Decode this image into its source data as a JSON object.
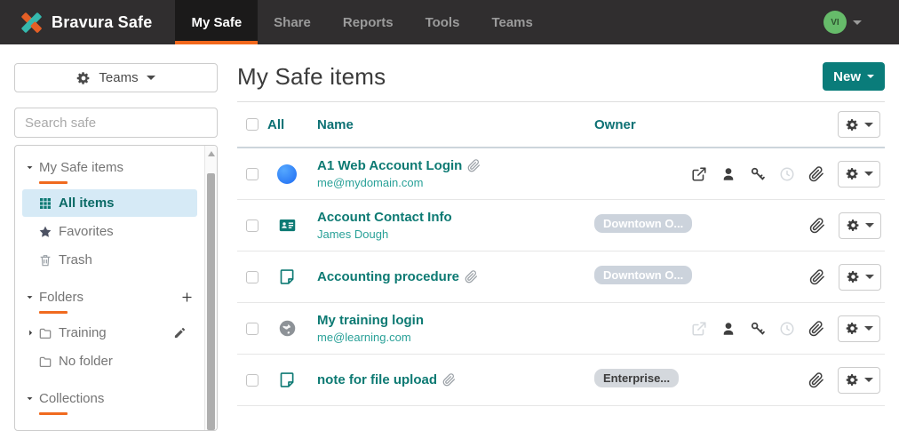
{
  "navbar": {
    "brand": "Bravura Safe",
    "items": [
      {
        "label": "My Safe",
        "active": true
      },
      {
        "label": "Share",
        "active": false
      },
      {
        "label": "Reports",
        "active": false
      },
      {
        "label": "Tools",
        "active": false
      },
      {
        "label": "Teams",
        "active": false
      }
    ],
    "avatar_initials": "VI"
  },
  "sidebar": {
    "teams_button": "Teams",
    "search_placeholder": "Search safe",
    "groups": [
      {
        "header": "My Safe items",
        "items": [
          {
            "label": "All items",
            "icon": "grid",
            "selected": true
          },
          {
            "label": "Favorites",
            "icon": "star",
            "selected": false
          },
          {
            "label": "Trash",
            "icon": "trash",
            "selected": false
          }
        ]
      },
      {
        "header": "Folders",
        "header_action": "plus",
        "items": [
          {
            "label": "Training",
            "icon": "folder",
            "caret": "right",
            "action": "pencil",
            "selected": false
          },
          {
            "label": "No folder",
            "icon": "folder",
            "selected": false
          }
        ]
      },
      {
        "header": "Collections",
        "items": []
      }
    ]
  },
  "main": {
    "title": "My Safe items",
    "new_button": "New",
    "table": {
      "select_all_label": "All",
      "name_column": "Name",
      "owner_column": "Owner",
      "rows": [
        {
          "name": "A1 Web Account Login",
          "name_attachment": true,
          "subtitle": "me@mydomain.com",
          "icon": "favicon",
          "owner_badge": null,
          "actions": [
            {
              "icon": "external-link",
              "disabled": false
            },
            {
              "icon": "person",
              "disabled": false
            },
            {
              "icon": "key",
              "disabled": false
            },
            {
              "icon": "clock",
              "disabled": true
            },
            {
              "icon": "paperclip",
              "disabled": false
            }
          ]
        },
        {
          "name": "Account Contact Info",
          "name_attachment": false,
          "subtitle": "James Dough",
          "icon": "id-card",
          "owner_badge": {
            "label": "Downtown O...",
            "style": "light"
          },
          "actions": [
            {
              "icon": "paperclip",
              "disabled": false
            }
          ]
        },
        {
          "name": "Accounting procedure",
          "name_attachment": true,
          "subtitle": "",
          "icon": "note",
          "owner_badge": {
            "label": "Downtown O...",
            "style": "light"
          },
          "actions": [
            {
              "icon": "paperclip",
              "disabled": false
            }
          ]
        },
        {
          "name": "My training login",
          "name_attachment": false,
          "subtitle": "me@learning.com",
          "icon": "globe",
          "owner_badge": null,
          "actions": [
            {
              "icon": "external-link",
              "disabled": true
            },
            {
              "icon": "person",
              "disabled": false
            },
            {
              "icon": "key",
              "disabled": false
            },
            {
              "icon": "clock",
              "disabled": true
            },
            {
              "icon": "paperclip",
              "disabled": false
            }
          ]
        },
        {
          "name": "note for file upload",
          "name_attachment": true,
          "subtitle": "",
          "icon": "note",
          "owner_badge": {
            "label": "Enterprise...",
            "style": "gray"
          },
          "actions": [
            {
              "icon": "paperclip",
              "disabled": false
            }
          ]
        }
      ]
    }
  },
  "colors": {
    "navbar_bg": "#302e2f",
    "accent_orange": "#f2681c",
    "teal": "#0e7a74",
    "new_button_bg": "#0a7c7a",
    "selected_item_bg": "#d6eaf6",
    "avatar_green": "#66bb6a",
    "badge_light_bg": "#ccd3dc",
    "badge_gray_bg": "#d4d8dd"
  }
}
